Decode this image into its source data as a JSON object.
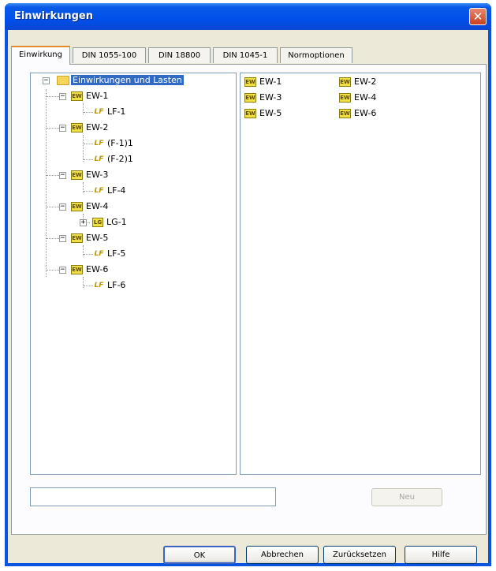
{
  "window": {
    "title": "Einwirkungen",
    "close_symbol": "✕"
  },
  "tabs": [
    {
      "label": "Einwirkung",
      "active": true
    },
    {
      "label": "DIN 1055-100",
      "active": false
    },
    {
      "label": "DIN 18800",
      "active": false
    },
    {
      "label": "DIN 1045-1",
      "active": false
    },
    {
      "label": "Normoptionen",
      "active": false
    }
  ],
  "tree": {
    "root": {
      "label": "Einwirkungen und Lasten",
      "icon": "folder-icon",
      "expander": "−"
    },
    "nodes": [
      {
        "label": "EW-1",
        "icon_text": "EW",
        "expander": "−",
        "children": [
          {
            "label": "LF-1",
            "icon_text": "LF"
          }
        ]
      },
      {
        "label": "EW-2",
        "icon_text": "EW",
        "expander": "−",
        "children": [
          {
            "label": "(F-1)1",
            "icon_text": "LF"
          },
          {
            "label": "(F-2)1",
            "icon_text": "LF"
          }
        ]
      },
      {
        "label": "EW-3",
        "icon_text": "EW",
        "expander": "−",
        "children": [
          {
            "label": "LF-4",
            "icon_text": "LF"
          }
        ]
      },
      {
        "label": "EW-4",
        "icon_text": "EW",
        "expander": "−",
        "children": [
          {
            "label": "LG-1",
            "icon_text": "LG",
            "expander": "+"
          }
        ]
      },
      {
        "label": "EW-5",
        "icon_text": "EW",
        "expander": "−",
        "children": [
          {
            "label": "LF-5",
            "icon_text": "LF"
          }
        ]
      },
      {
        "label": "EW-6",
        "icon_text": "EW",
        "expander": "−",
        "children": [
          {
            "label": "LF-6",
            "icon_text": "LF"
          }
        ]
      }
    ]
  },
  "list": {
    "icon_text": "EW",
    "items": [
      "EW-1",
      "EW-2",
      "EW-3",
      "EW-4",
      "EW-5",
      "EW-6"
    ]
  },
  "input": {
    "value": ""
  },
  "buttons": {
    "new": "Neu",
    "ok": "OK",
    "cancel": "Abbrechen",
    "reset": "Zurücksetzen",
    "help": "Hilfe"
  },
  "colors": {
    "titlebar": "#0050ea",
    "selection": "#316ac5",
    "dialog_bg": "#ece9d8",
    "icon_yellow": "#f0e040"
  }
}
